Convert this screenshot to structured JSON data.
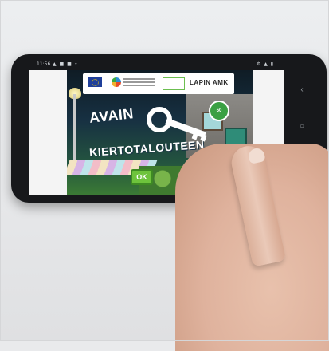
{
  "game": {
    "title_line1": "AVAIN",
    "title_line2": "KIERTOTALOUTEEN",
    "ok_label": "OK",
    "badge_text": "50",
    "sponsor_text": "LAPIN AMK"
  },
  "status_bar": {
    "time": "11:56",
    "left_icons": "▲ ■ ■ •",
    "right_icons": "⚙ ▲ ▮"
  },
  "nav": {
    "back": "‹",
    "home": "○",
    "recent": "|||",
    "extra": "⊘"
  },
  "colors": {
    "ok_button": "#6ec33c",
    "badge": "#3aa043",
    "door": "#2f8c78"
  }
}
